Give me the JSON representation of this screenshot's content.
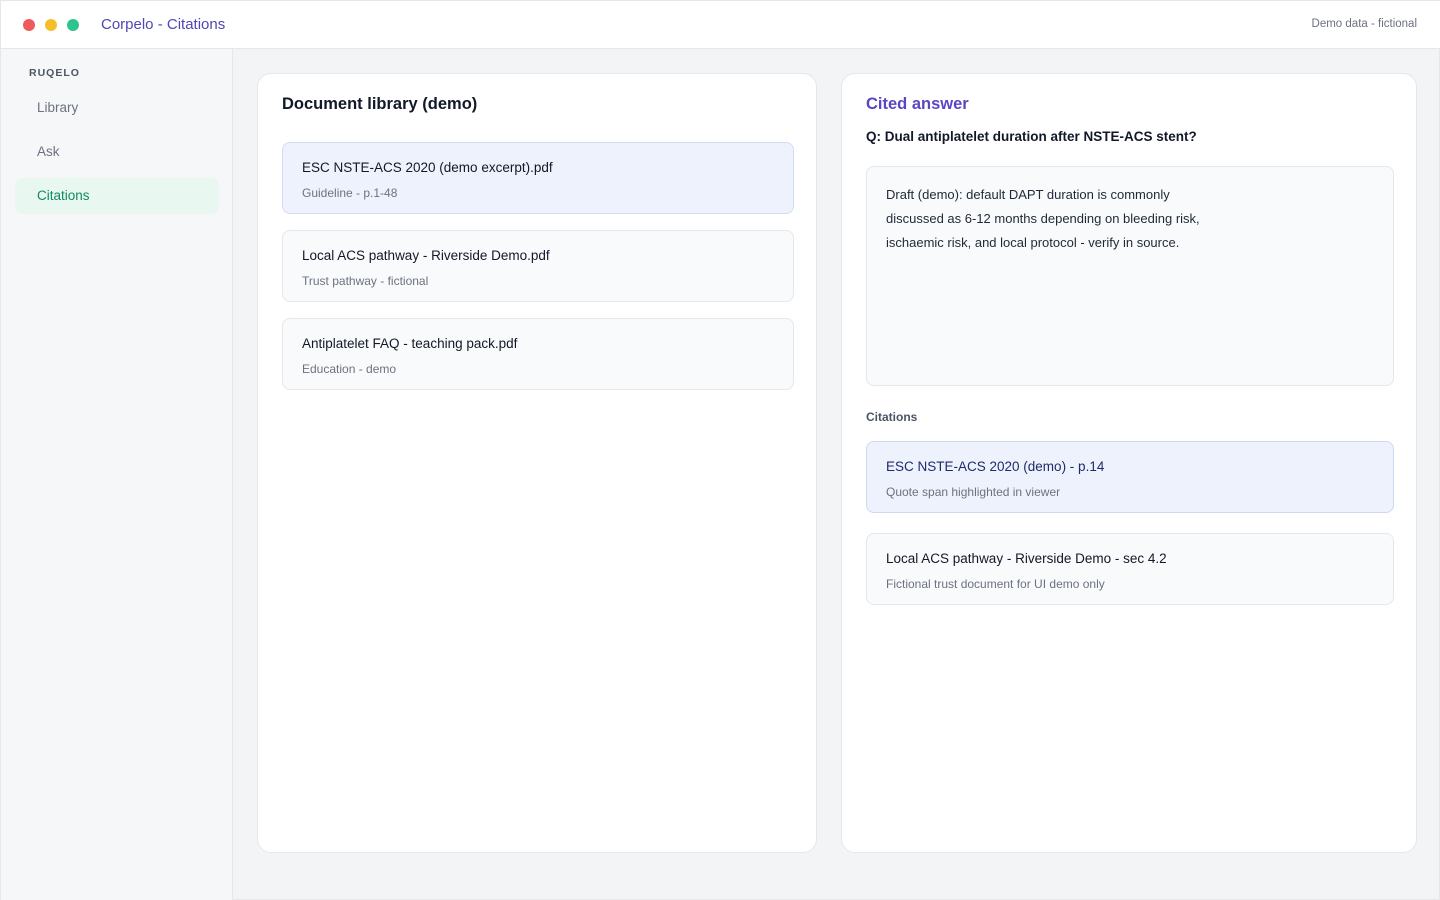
{
  "window": {
    "title": "Corpelo - Citations",
    "demo_note": "Demo data - fictional"
  },
  "sidebar": {
    "brand": "RUQELO",
    "items": [
      {
        "label": "Library",
        "active": false
      },
      {
        "label": "Ask",
        "active": false
      },
      {
        "label": "Citations",
        "active": true
      }
    ]
  },
  "library": {
    "title": "Document library (demo)",
    "documents": [
      {
        "name": "ESC NSTE-ACS 2020 (demo excerpt).pdf",
        "meta": "Guideline - p.1-48",
        "selected": true
      },
      {
        "name": "Local ACS pathway - Riverside Demo.pdf",
        "meta": "Trust pathway - fictional",
        "selected": false
      },
      {
        "name": "Antiplatelet FAQ - teaching pack.pdf",
        "meta": "Education - demo",
        "selected": false
      }
    ]
  },
  "answer": {
    "title": "Cited answer",
    "question": "Q: Dual antiplatelet duration after NSTE-ACS stent?",
    "text": "Draft (demo): default DAPT duration is commonly discussed as 6-12 months depending on bleeding risk, ischaemic risk, and local protocol - verify in source.",
    "citations_label": "Citations",
    "citations": [
      {
        "title": "ESC NSTE-ACS 2020 (demo) - p.14",
        "subtitle": "Quote span highlighted in viewer",
        "selected": true
      },
      {
        "title": "Local ACS pathway - Riverside Demo - sec 4.2",
        "subtitle": "Fictional trust document for UI demo only",
        "selected": false
      }
    ]
  },
  "colors": {
    "accent": "#5b45c4",
    "active_nav": "#0f8a63",
    "selected_bg": "#eef2fc"
  }
}
